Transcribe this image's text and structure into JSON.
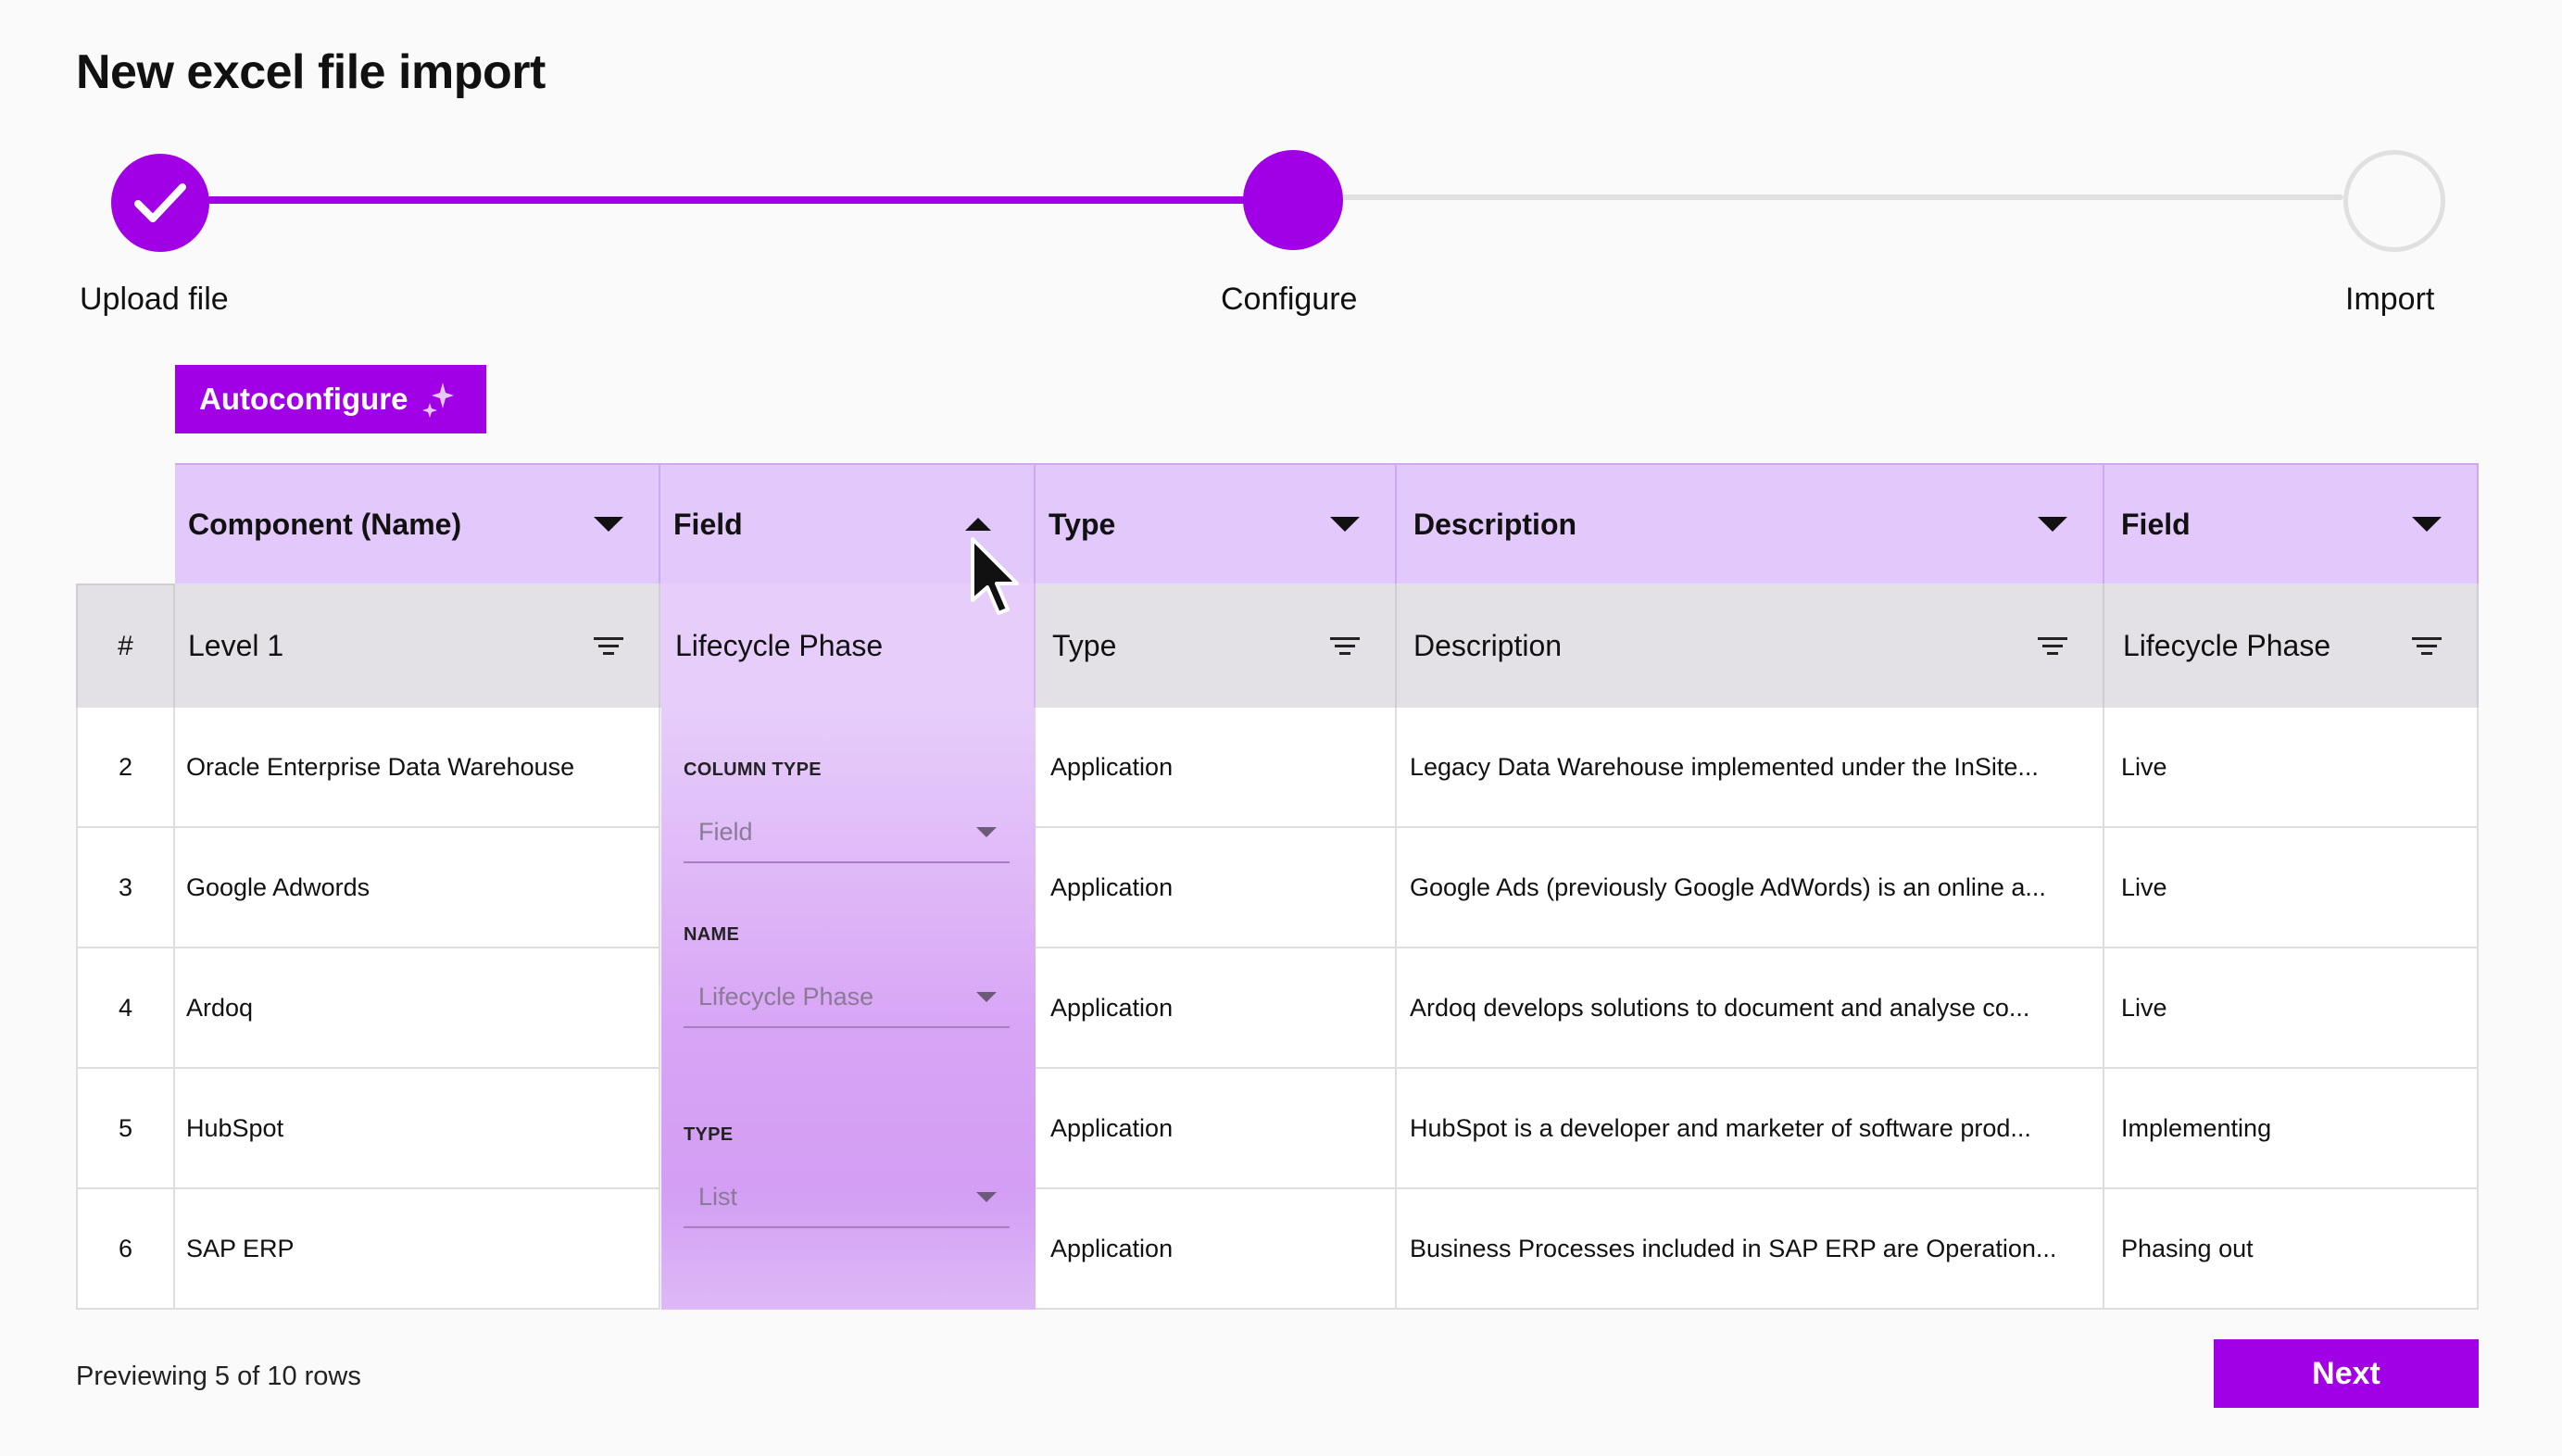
{
  "page": {
    "title": "New excel file import"
  },
  "stepper": {
    "steps": [
      {
        "label": "Upload file",
        "state": "complete"
      },
      {
        "label": "Configure",
        "state": "current"
      },
      {
        "label": "Import",
        "state": "pending"
      }
    ]
  },
  "toolbar": {
    "autoconfigure_label": "Autoconfigure"
  },
  "mapping_headers": [
    "Component (Name)",
    "Field",
    "Type",
    "Description",
    "Field"
  ],
  "source_headers": {
    "index": "#",
    "cols": [
      "Level 1",
      "Lifecycle Phase",
      "Type",
      "Description",
      "Lifecycle Phase"
    ]
  },
  "rows": [
    {
      "num": "2",
      "name": "Oracle Enterprise Data Warehouse",
      "type": "Application",
      "description": "Legacy Data Warehouse implemented under the InSite...",
      "phase": "Live"
    },
    {
      "num": "3",
      "name": "Google Adwords",
      "type": "Application",
      "description": "Google Ads (previously Google AdWords) is an online a...",
      "phase": "Live"
    },
    {
      "num": "4",
      "name": "Ardoq",
      "type": "Application",
      "description": "Ardoq develops solutions to document and analyse co...",
      "phase": "Live"
    },
    {
      "num": "5",
      "name": "HubSpot",
      "type": "Application",
      "description": "HubSpot is a developer and marketer of software prod...",
      "phase": "Implementing"
    },
    {
      "num": "6",
      "name": "SAP ERP",
      "type": "Application",
      "description": "Business Processes included in SAP ERP are Operation...",
      "phase": "Phasing out"
    }
  ],
  "field_config": {
    "column_type_label": "COLUMN TYPE",
    "column_type_value": "Field",
    "name_label": "NAME",
    "name_value": "Lifecycle Phase",
    "type_label": "TYPE",
    "type_value": "List"
  },
  "footer": {
    "preview_text": "Previewing 5 of 10 rows",
    "next_label": "Next"
  },
  "colors": {
    "accent": "#a100e6",
    "header_mapping": "#e2c8fb",
    "header_source": "#e4e1e6"
  }
}
